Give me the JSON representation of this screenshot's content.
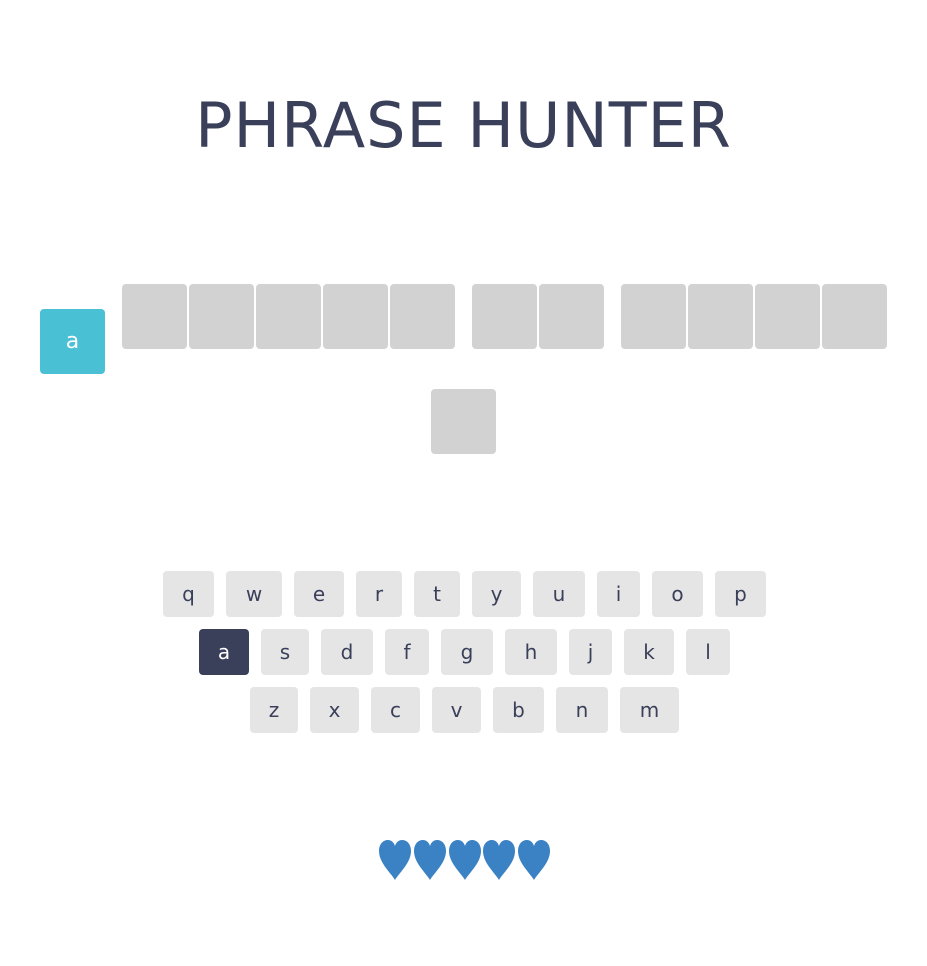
{
  "header": {
    "title": "PHRASE HUNTER"
  },
  "phrase": {
    "revealed_letter": "a",
    "word_lengths": [
      5,
      2,
      4,
      1
    ]
  },
  "keyboard": {
    "row1": [
      "q",
      "w",
      "e",
      "r",
      "t",
      "y",
      "u",
      "i",
      "o",
      "p"
    ],
    "row2": [
      "a",
      "s",
      "d",
      "f",
      "g",
      "h",
      "j",
      "k",
      "l"
    ],
    "row3": [
      "z",
      "x",
      "c",
      "v",
      "b",
      "n",
      "m"
    ],
    "chosen_key": "a"
  },
  "scoreboard": {
    "lives_remaining": 5,
    "heart_icon": "blue-heart-icon"
  },
  "colors": {
    "title": "#3a405a",
    "tile_hidden": "#d2d2d2",
    "tile_shown": "#4ac0d4",
    "key_default": "#e5e5e5",
    "key_chosen": "#3a405a",
    "heart": "#3b82c4"
  }
}
